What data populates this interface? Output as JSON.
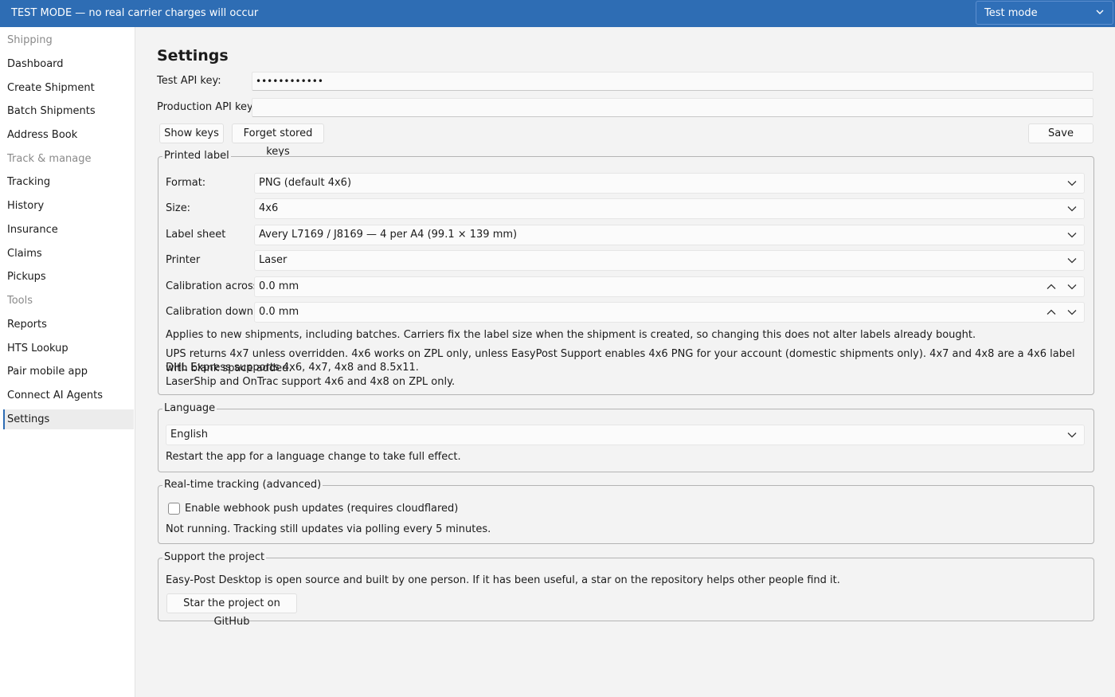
{
  "banner": {
    "text": "TEST MODE — no real carrier charges will occur",
    "mode_select_value": "Test mode",
    "accent_color": "#2e6db4"
  },
  "sidebar": {
    "items": [
      {
        "label": "Shipping",
        "section": true
      },
      {
        "label": "Dashboard"
      },
      {
        "label": "Create Shipment"
      },
      {
        "label": "Batch Shipments"
      },
      {
        "label": "Address Book"
      },
      {
        "label": "Track & manage",
        "section": true
      },
      {
        "label": "Tracking"
      },
      {
        "label": "History"
      },
      {
        "label": "Insurance"
      },
      {
        "label": "Claims"
      },
      {
        "label": "Pickups"
      },
      {
        "label": "Tools",
        "section": true
      },
      {
        "label": "Reports"
      },
      {
        "label": "HTS Lookup"
      },
      {
        "label": "Pair mobile app"
      },
      {
        "label": "Connect AI Agents"
      },
      {
        "label": "Settings",
        "active": true
      }
    ]
  },
  "settings": {
    "title": "Settings",
    "test_key_label": "Test API key:",
    "test_key_value": "••••••••••••",
    "prod_key_label": "Production API key:",
    "prod_key_value": "",
    "show_keys": "Show keys",
    "forget_keys": "Forget stored keys",
    "save": "Save"
  },
  "printed_label": {
    "legend": "Printed label",
    "format_label": "Format:",
    "format_value": "PNG (default 4x6)",
    "size_label": "Size:",
    "size_value": "4x6",
    "sheet_label": "Label sheet",
    "sheet_value": "Avery L7169 / J8169 — 4 per A4 (99.1 × 139 mm)",
    "printer_label": "Printer",
    "printer_value": "Laser",
    "cal_across_label": "Calibration across",
    "cal_across_value": "0.0 mm",
    "cal_down_label": "Calibration down",
    "cal_down_value": "0.0 mm",
    "note1": "Applies to new shipments, including batches. Carriers fix the label size when the shipment is created, so changing this does not alter labels already bought.",
    "note2": "UPS returns 4x7 unless overridden. 4x6 works on ZPL only, unless EasyPost Support enables 4x6 PNG for your account (domestic shipments only). 4x7 and 4x8 are a 4x6 label with blank space added.",
    "note3": "DHL Express supports 4x6, 4x7, 4x8 and 8.5x11.",
    "note4": "LaserShip and OnTrac support 4x6 and 4x8 on ZPL only."
  },
  "language": {
    "legend": "Language",
    "value": "English",
    "note": "Restart the app for a language change to take full effect."
  },
  "tracking": {
    "legend": "Real-time tracking (advanced)",
    "checkbox_label": "Enable webhook push updates (requires cloudflared)",
    "checked": false,
    "status": "Not running. Tracking still updates via polling every 5 minutes."
  },
  "support": {
    "legend": "Support the project",
    "text": "Easy-Post Desktop is open source and built by one person. If it has been useful, a star on the repository helps other people find it.",
    "button": "Star the project on GitHub"
  }
}
